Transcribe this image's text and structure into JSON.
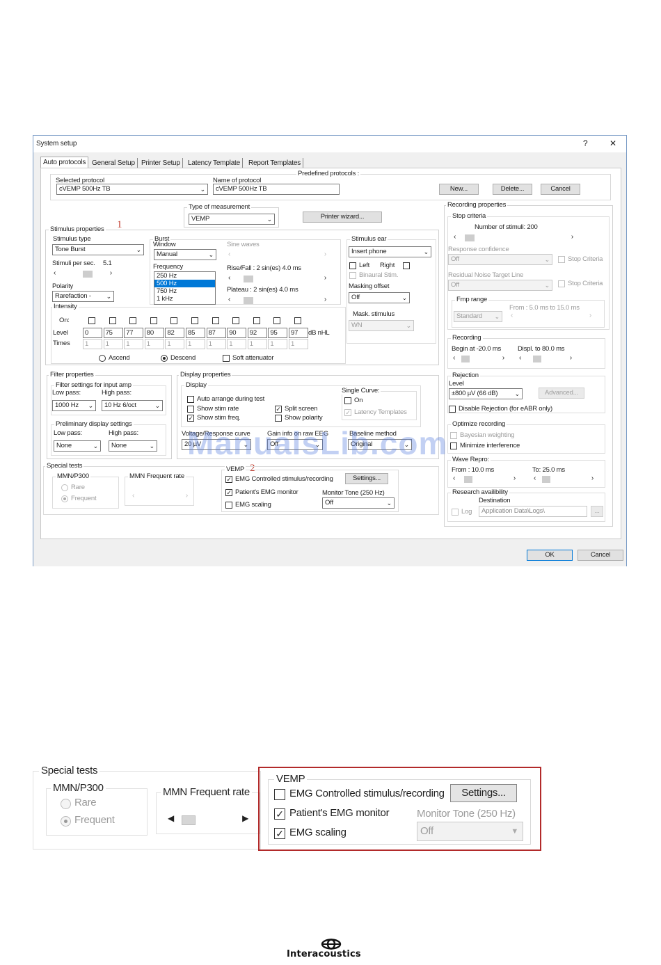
{
  "window": {
    "title": "System setup",
    "help": "?",
    "close": "✕"
  },
  "tabs": [
    "Auto protocols",
    "General Setup",
    "Printer Setup",
    "Latency Template",
    "Report Templates"
  ],
  "protocols": {
    "predefined_label": "Predefined protocols :",
    "selected_label": "Selected protocol",
    "selected_value": "cVEMP 500Hz TB",
    "name_label": "Name of protocol",
    "name_value": "cVEMP 500Hz TB",
    "new": "New...",
    "delete": "Delete...",
    "cancel": "Cancel"
  },
  "measurement": {
    "label": "Type of measurement",
    "value": "VEMP",
    "printer_wizard": "Printer wizard..."
  },
  "markers": {
    "one": "1",
    "two": "2"
  },
  "stimulus": {
    "title": "Stimulus properties",
    "type_label": "Stimulus type",
    "type_value": "Tone Burst",
    "rate_label": "Stimuli per sec.",
    "rate_value": "5.1",
    "polarity_label": "Polarity",
    "polarity_value": "Rarefaction -",
    "burst_label": "Burst",
    "window_label": "Window",
    "window_value": "Manual",
    "sine_label": "Sine waves",
    "freq_label": "Frequency",
    "freq_items": [
      "250 Hz",
      "500 Hz",
      "750 Hz",
      "1 kHz"
    ],
    "rise_label": "Rise/Fall :  2 sin(es) 4.0 ms",
    "plateau_label": "Plateau :   2 sin(es) 4.0 ms",
    "ear_label": "Stimulus ear",
    "ear_value": "Insert phone",
    "left": "Left",
    "right": "Right",
    "binaural": "Binaural Stim.",
    "masking_label": "Masking offset",
    "masking_value": "Off",
    "mask_stim_label": "Mask. stimulus",
    "mask_stim_value": "WN"
  },
  "intensity": {
    "title": "Intensity",
    "on_label": "On:",
    "level_label": "Level",
    "times_label": "Times",
    "levels": [
      "0",
      "75",
      "77",
      "80",
      "82",
      "85",
      "87",
      "90",
      "92",
      "95",
      "97"
    ],
    "times": [
      "1",
      "1",
      "1",
      "1",
      "1",
      "1",
      "1",
      "1",
      "1",
      "1",
      "1"
    ],
    "unit": "dB nHL",
    "ascend": "Ascend",
    "descend": "Descend",
    "soft": "Soft attenuator"
  },
  "filter": {
    "title": "Filter properties",
    "input_label": "Filter settings for input amp",
    "low_label": "Low pass:",
    "low_value": "1000 Hz",
    "high_label": "High pass:",
    "high_value": "10 Hz 6/oct",
    "pre_label": "Preliminary display settings",
    "pre_low_label": "Low pass:",
    "pre_low_value": "None",
    "pre_high_label": "High pass:",
    "pre_high_value": "None"
  },
  "display": {
    "title": "Display properties",
    "sub": "Display",
    "auto_arrange": "Auto arrange during test",
    "show_rate": "Show stim rate",
    "show_freq": "Show stim freq.",
    "split": "Split screen",
    "show_polarity": "Show polarity",
    "single_label": "Single Curve:",
    "single_on": "On",
    "latency": "Latency Templates",
    "volt_label": "Voltage/Response curve",
    "volt_value": "20 µV",
    "gain_label": "Gain info on raw EEG",
    "gain_value": "Off",
    "baseline_label": "Baseline method",
    "baseline_value": "Original"
  },
  "special": {
    "title": "Special tests",
    "mmn": "MMN/P300",
    "rare": "Rare",
    "frequent": "Frequent",
    "mmn_rate": "MMN Frequent rate",
    "vemp": "VEMP",
    "emg_controlled": "EMG Controlled stimulus/recording",
    "settings": "Settings...",
    "emg_monitor": "Patient's EMG monitor",
    "emg_scaling": "EMG scaling",
    "monitor_tone_label": "Monitor Tone (250 Hz)",
    "monitor_tone_value": "Off"
  },
  "recording_props": {
    "title": "Recording properties",
    "stop": "Stop criteria",
    "num_stimuli": "Number of stimuli:  200",
    "resp_conf": "Response confidence",
    "resp_value": "Off",
    "stop_crit": "Stop Criteria",
    "residual": "Residual Noise Target Line",
    "res_value": "Off",
    "fmp_range": "Fmp range",
    "fmp_value": "Standard",
    "fmp_from": "From : 5.0 ms to 15.0 ms",
    "recording": "Recording",
    "begin": "Begin at  -20.0 ms",
    "displ": "Displ. to   80.0 ms",
    "rejection": "Rejection",
    "level": "Level",
    "level_value": "±800 µV (66 dB)",
    "advanced": "Advanced...",
    "disable_rej": "Disable Rejection (for eABR only)",
    "optimize": "Optimize recording",
    "bayesian": "Bayesian weighting",
    "minimize": "Minimize interference",
    "wave": "Wave Repro:",
    "from": "From :  10.0 ms",
    "to": "To:   25.0 ms",
    "research": "Research availibility",
    "dest": "Destination",
    "log": "Log",
    "dest_value": "Application Data\\Logs\\",
    "browse": "..."
  },
  "footer": {
    "ok": "OK",
    "cancel": "Cancel"
  },
  "watermark": "ManualsLib.com",
  "brand": "Interacoustics"
}
